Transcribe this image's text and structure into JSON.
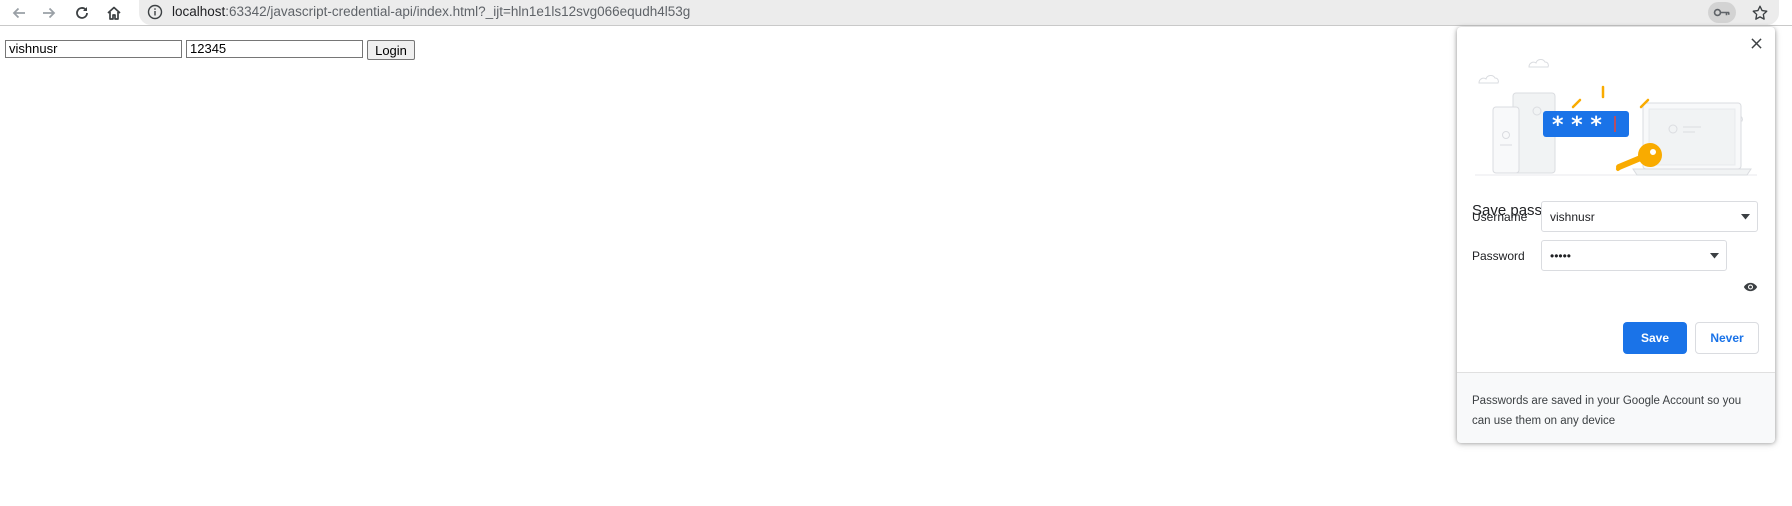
{
  "browser": {
    "url_host": "localhost",
    "url_rest": ":63342/javascript-credential-api/index.html?_ijt=hln1e1ls12svg066equdh4l53g"
  },
  "page": {
    "username_value": "vishnusr",
    "password_value": "12345",
    "login_label": "Login"
  },
  "bubble": {
    "title": "Save password?",
    "username_label": "Username",
    "username_value": "vishnusr",
    "password_label": "Password",
    "password_value": "•••••",
    "save_label": "Save",
    "never_label": "Never",
    "footer_text": "Passwords are saved in your Google Account so you can use them on any device"
  },
  "colors": {
    "accent": "#1a73e8",
    "key_yellow": "#f9ab00"
  }
}
